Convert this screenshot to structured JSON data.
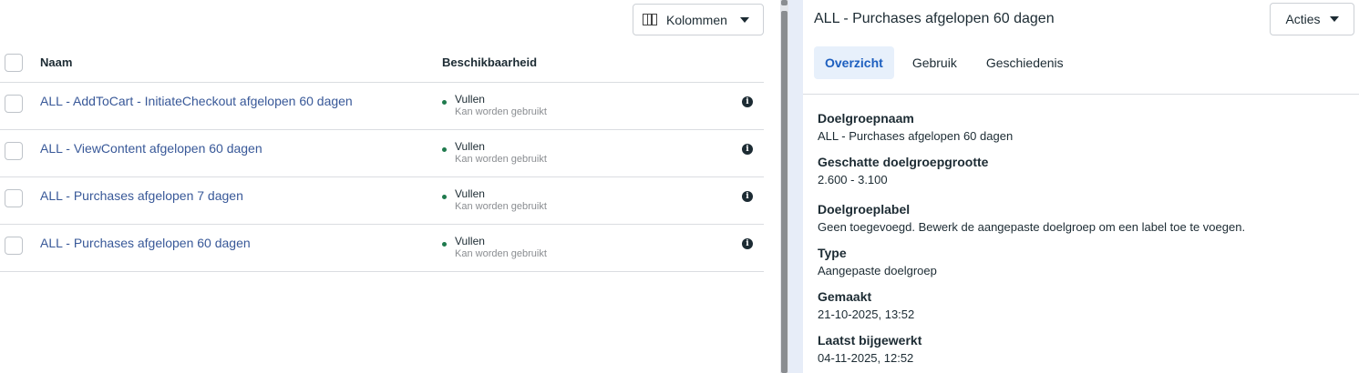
{
  "toolbar": {
    "columns_label": "Kolommen"
  },
  "table": {
    "headers": {
      "name": "Naam",
      "availability": "Beschikbaarheid"
    },
    "rows": [
      {
        "name": "ALL - AddToCart - InitiateCheckout afgelopen 60 dagen",
        "status": "Vullen",
        "status_sub": "Kan worden gebruikt"
      },
      {
        "name": "ALL - ViewContent afgelopen 60 dagen",
        "status": "Vullen",
        "status_sub": "Kan worden gebruikt"
      },
      {
        "name": "ALL - Purchases afgelopen 7 dagen",
        "status": "Vullen",
        "status_sub": "Kan worden gebruikt"
      },
      {
        "name": "ALL - Purchases afgelopen 60 dagen",
        "status": "Vullen",
        "status_sub": "Kan worden gebruikt"
      }
    ]
  },
  "panel": {
    "title": "ALL - Purchases afgelopen 60 dagen",
    "actions_label": "Acties",
    "tabs": [
      {
        "label": "Overzicht",
        "active": true
      },
      {
        "label": "Gebruik",
        "active": false
      },
      {
        "label": "Geschiedenis",
        "active": false
      }
    ],
    "fields": [
      {
        "label": "Doelgroepnaam",
        "value": "ALL - Purchases afgelopen 60 dagen"
      },
      {
        "label": "Geschatte doelgroepgrootte",
        "value": "2.600 - 3.100"
      },
      {
        "label": "Doelgroeplabel",
        "value": "Geen toegevoegd. Bewerk de aangepaste doelgroep om een label toe te voegen."
      },
      {
        "label": "Type",
        "value": "Aangepaste doelgroep"
      },
      {
        "label": "Gemaakt",
        "value": "21-10-2025, 13:52"
      },
      {
        "label": "Laatst bijgewerkt",
        "value": "04-11-2025, 12:52"
      }
    ]
  },
  "colors": {
    "link": "#385898",
    "status_ready": "#1f7a4d",
    "tab_active_bg": "#e7f0fb",
    "tab_active_text": "#1d5fbf"
  },
  "icons": {
    "columns": "columns-icon",
    "dropdown": "caret-down-icon",
    "info": "info-icon"
  }
}
